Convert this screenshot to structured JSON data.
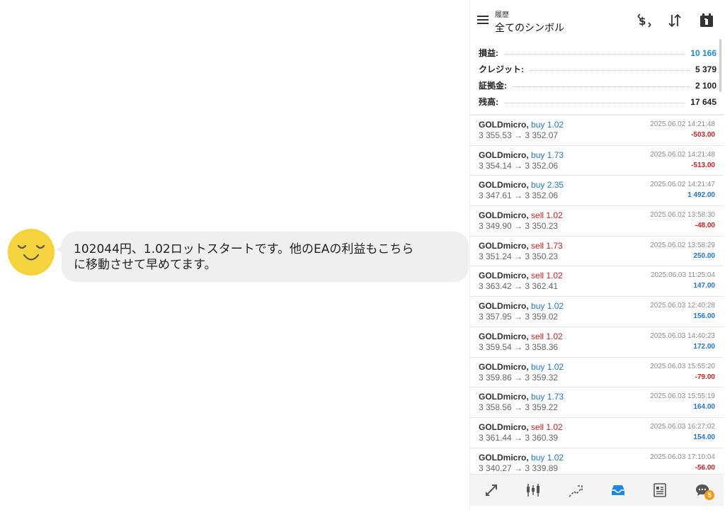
{
  "chat": {
    "message_line1": "102044円、1.02ロットスタートです。他のEAの利益もこちら",
    "message_line2": "に移動させて早めてます。"
  },
  "header": {
    "subtitle": "履歴",
    "title": "全てのシンボル",
    "icons": [
      "menu-icon",
      "deposit-icon",
      "sort-icon",
      "calendar-icon"
    ]
  },
  "summary": [
    {
      "label": "損益:",
      "value": "10 166",
      "color": "#1e88e5"
    },
    {
      "label": "クレジット:",
      "value": "5 379",
      "color": "#222222"
    },
    {
      "label": "証拠金:",
      "value": "2 100",
      "color": "#222222"
    },
    {
      "label": "残高:",
      "value": "17 645",
      "color": "#222222"
    }
  ],
  "trades": [
    {
      "symbol": "GOLDmicro,",
      "dir": "buy",
      "lot": "buy 1.02",
      "prices": "3 355.53 → 3 352.07",
      "time": "2025.06.02 14:21:48",
      "profit": "-503.00",
      "sign": "neg"
    },
    {
      "symbol": "GOLDmicro,",
      "dir": "buy",
      "lot": "buy 1.73",
      "prices": "3 354.14 → 3 352.06",
      "time": "2025.06.02 14:21:48",
      "profit": "-513.00",
      "sign": "neg"
    },
    {
      "symbol": "GOLDmicro,",
      "dir": "buy",
      "lot": "buy 2.35",
      "prices": "3 347.61 → 3 352.06",
      "time": "2025.06.02 14:21:47",
      "profit": "1 492.00",
      "sign": "pos"
    },
    {
      "symbol": "GOLDmicro,",
      "dir": "sell",
      "lot": "sell 1.02",
      "prices": "3 349.90 → 3 350.23",
      "time": "2025.06.02 13:58:30",
      "profit": "-48.00",
      "sign": "neg"
    },
    {
      "symbol": "GOLDmicro,",
      "dir": "sell",
      "lot": "sell 1.73",
      "prices": "3 351.24 → 3 350.23",
      "time": "2025.06.02 13:58:29",
      "profit": "250.00",
      "sign": "pos"
    },
    {
      "symbol": "GOLDmicro,",
      "dir": "sell",
      "lot": "sell 1.02",
      "prices": "3 363.42 → 3 362.41",
      "time": "2025.06.03 11:25:04",
      "profit": "147.00",
      "sign": "pos"
    },
    {
      "symbol": "GOLDmicro,",
      "dir": "buy",
      "lot": "buy 1.02",
      "prices": "3 357.95 → 3 359.02",
      "time": "2025.06.03 12:40:28",
      "profit": "156.00",
      "sign": "pos"
    },
    {
      "symbol": "GOLDmicro,",
      "dir": "sell",
      "lot": "sell 1.02",
      "prices": "3 359.54 → 3 358.36",
      "time": "2025.06.03 14:40:23",
      "profit": "172.00",
      "sign": "pos"
    },
    {
      "symbol": "GOLDmicro,",
      "dir": "buy",
      "lot": "buy 1.02",
      "prices": "3 359.86 → 3 359.32",
      "time": "2025.06.03 15:55:20",
      "profit": "-79.00",
      "sign": "neg"
    },
    {
      "symbol": "GOLDmicro,",
      "dir": "buy",
      "lot": "buy 1.73",
      "prices": "3 358.56 → 3 359.22",
      "time": "2025.06.03 15:55:19",
      "profit": "164.00",
      "sign": "pos"
    },
    {
      "symbol": "GOLDmicro,",
      "dir": "sell",
      "lot": "sell 1.02",
      "prices": "3 361.44 → 3 360.39",
      "time": "2025.06.03 16:27:02",
      "profit": "154.00",
      "sign": "pos"
    },
    {
      "symbol": "GOLDmicro,",
      "dir": "buy",
      "lot": "buy 1.02",
      "prices": "3 340.27 → 3 339.89",
      "time": "2025.06.03 17:10:04",
      "profit": "-56.00",
      "sign": "neg"
    }
  ],
  "bottom_nav": {
    "items": [
      "quotes-icon",
      "chart-icon",
      "trade-icon",
      "history-icon",
      "news-icon",
      "chat-icon"
    ],
    "active": "history-icon",
    "chat_badge": "5"
  },
  "colors": {
    "buy": "#1e74d8",
    "sell": "#d11d1d",
    "accent": "#1e88e5",
    "avatar": "#f5d33d",
    "badge": "#f49b1a"
  }
}
